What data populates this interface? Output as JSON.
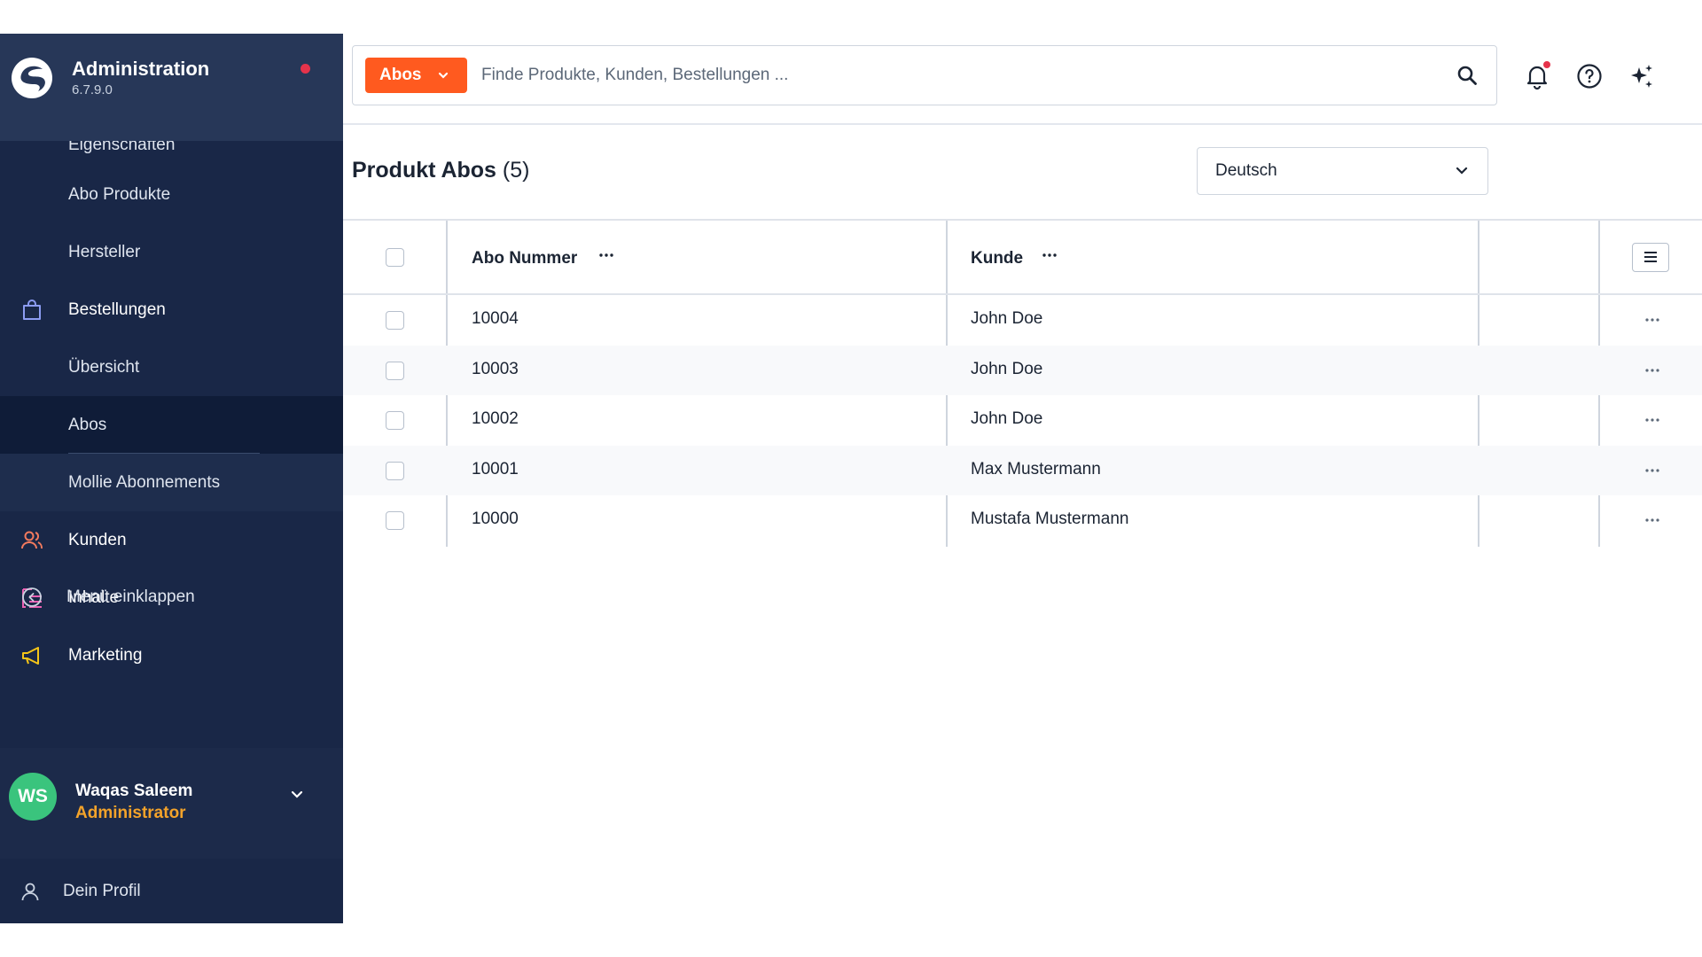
{
  "app": {
    "title": "Administration",
    "version": "6.7.9.0"
  },
  "sidebar": {
    "items": [
      {
        "label": "Eigenschaften",
        "level": "sub"
      },
      {
        "label": "Abo Produkte",
        "level": "sub"
      },
      {
        "label": "Hersteller",
        "level": "sub"
      },
      {
        "label": "Bestellungen",
        "level": "main",
        "icon": "shopping-bag-icon"
      },
      {
        "label": "Übersicht",
        "level": "sub"
      },
      {
        "label": "Abos",
        "level": "sub",
        "active": true
      },
      {
        "label": "Mollie Abonnements",
        "level": "sub"
      },
      {
        "label": "Kunden",
        "level": "main",
        "icon": "users-icon"
      },
      {
        "label": "Inhalte",
        "level": "main",
        "icon": "content-list-icon"
      },
      {
        "label": "Marketing",
        "level": "main",
        "icon": "megaphone-icon"
      }
    ],
    "collapse_label": "Menü einklappen",
    "user": {
      "initials": "WS",
      "name": "Waqas Saleem",
      "role": "Administrator"
    },
    "profile_label": "Dein Profil"
  },
  "search": {
    "type_label": "Abos",
    "placeholder": "Finde Produkte, Kunden, Bestellungen ...",
    "value": ""
  },
  "page": {
    "title": "Produkt Abos",
    "count": "(5)",
    "language": "Deutsch"
  },
  "table": {
    "columns": [
      "Abo Nummer",
      "Kunde"
    ],
    "rows": [
      {
        "number": "10004",
        "customer": "John Doe"
      },
      {
        "number": "10003",
        "customer": "John Doe"
      },
      {
        "number": "10002",
        "customer": "John Doe"
      },
      {
        "number": "10001",
        "customer": "Max Mustermann"
      },
      {
        "number": "10000",
        "customer": "Mustafa Mustermann"
      }
    ]
  },
  "colors": {
    "sidebar": "#192747",
    "accent": "#ff5a1f",
    "avatar": "#3ac47d",
    "role": "#f4a32a",
    "notification": "#e5334b"
  }
}
